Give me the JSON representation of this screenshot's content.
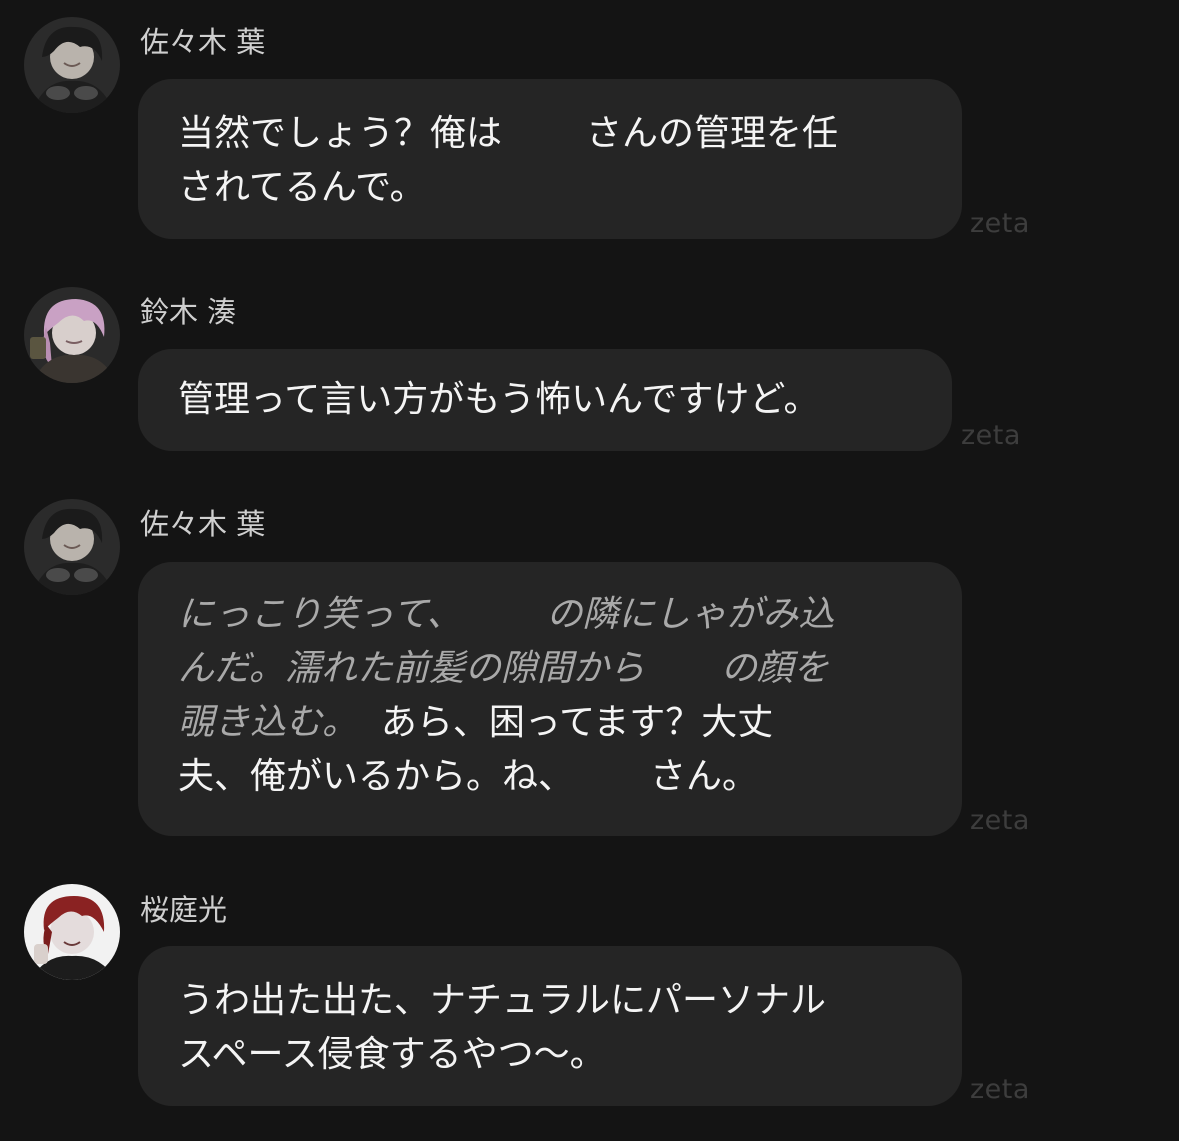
{
  "messages": [
    {
      "speaker": "佐々木 葉",
      "avatar": "avatar-dark-hair-goggles",
      "lines": [
        [
          "当然でしょう？俺は",
          "さんの管理を任"
        ],
        [
          "されてるんで。"
        ]
      ],
      "watermark": "zeta"
    },
    {
      "speaker": "鈴木 湊",
      "avatar": "avatar-pink-hair",
      "lines": [
        [
          "管理って言い方がもう怖いんですけど。"
        ]
      ],
      "watermark": "zeta"
    },
    {
      "speaker": "佐々木 葉",
      "avatar": "avatar-dark-hair-goggles",
      "narration": {
        "line1a": "にっこり笑って、",
        "line1b": "の隣にしゃがみ込",
        "line2a": "んだ。濡れた前髪の隙間から",
        "line2b": "の顔を",
        "line3": "覗き込む。"
      },
      "speech": {
        "line3": "あら、困ってます？大丈",
        "line4a": "夫、俺がいるから。ね、",
        "line4b": "さん。"
      },
      "watermark": "zeta"
    },
    {
      "speaker": "桜庭光",
      "avatar": "avatar-red-hair",
      "lines": [
        [
          "うわ出た出た、ナチュラルにパーソナル"
        ],
        [
          "スペース侵食するやつ〜。"
        ]
      ],
      "watermark": "zeta"
    }
  ],
  "colors": {
    "background": "#141414",
    "bubble": "#252525",
    "text": "#f4f4f4",
    "narration": "#a9a9a9",
    "name": "#cfcfcf",
    "watermark": "#3d3d3d"
  }
}
